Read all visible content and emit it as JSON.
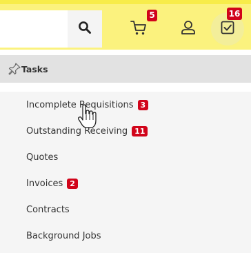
{
  "header": {
    "search_placeholder": "",
    "cart_count": "5",
    "tasks_count": "16"
  },
  "menu": {
    "title": "Tasks",
    "items": [
      {
        "label": "Incomplete Requisitions",
        "count": "3"
      },
      {
        "label": "Outstanding Receiving",
        "count": "11"
      },
      {
        "label": "Quotes",
        "count": ""
      },
      {
        "label": "Invoices",
        "count": "2"
      },
      {
        "label": "Contracts",
        "count": ""
      },
      {
        "label": "Background Jobs",
        "count": ""
      }
    ]
  },
  "colors": {
    "topbar": "#fbf27e",
    "badge": "#d1041a",
    "menu_header": "#e2e2e2",
    "menu_bg": "#f5f5f5"
  },
  "icons": [
    "search-icon",
    "cart-icon",
    "user-icon",
    "tasks-checkbox-icon",
    "pin-icon",
    "hand-pointer-cursor"
  ]
}
